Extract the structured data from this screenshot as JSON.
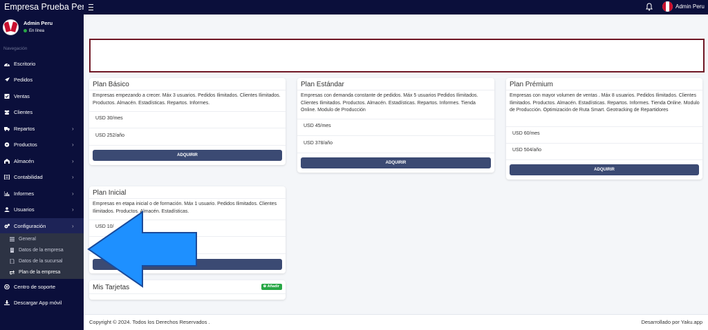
{
  "app": {
    "title": "Empresa Prueba Perú"
  },
  "topbar": {
    "user_name": "Admin Peru"
  },
  "sidebar": {
    "user": {
      "name": "Admin Peru",
      "status": "En línea"
    },
    "section_header": "Navegación",
    "items": [
      {
        "label": "Escritorio",
        "icon": "dashboard-icon",
        "has_children": false
      },
      {
        "label": "Pedidos",
        "icon": "rocket-icon",
        "has_children": false
      },
      {
        "label": "Ventas",
        "icon": "checkbox-icon",
        "has_children": false
      },
      {
        "label": "Clientes",
        "icon": "users-icon",
        "has_children": false
      },
      {
        "label": "Repartos",
        "icon": "truck-icon",
        "has_children": true
      },
      {
        "label": "Productos",
        "icon": "product-icon",
        "has_children": true
      },
      {
        "label": "Almacén",
        "icon": "warehouse-icon",
        "has_children": true
      },
      {
        "label": "Contabilidad",
        "icon": "calculator-icon",
        "has_children": true
      },
      {
        "label": "Informes",
        "icon": "chart-icon",
        "has_children": true
      },
      {
        "label": "Usuarios",
        "icon": "user-icon",
        "has_children": true
      },
      {
        "label": "Configuración",
        "icon": "gears-icon",
        "has_children": true
      },
      {
        "label": "Centro de soporte",
        "icon": "support-icon",
        "has_children": false
      },
      {
        "label": "Descargar App móvil",
        "icon": "download-icon",
        "has_children": false
      }
    ],
    "submenu": [
      {
        "label": "General",
        "icon": "list-icon"
      },
      {
        "label": "Datos de la empresa",
        "icon": "building-icon"
      },
      {
        "label": "Datos de la sucursal",
        "icon": "file-icon"
      },
      {
        "label": "Plan de la empresa",
        "icon": "exchange-icon"
      }
    ]
  },
  "plans": [
    {
      "title": "Plan Básico",
      "description": "Empresas empezando a crecer. Máx 3 usuarios. Pedidos Ilimitados. Clientes Ilimitados. Productos. Almacén. Estadísticas. Repartos. Informes.",
      "price_monthly": "USD 30/mes",
      "price_yearly": "USD 252/año",
      "button": "ADQUIRIR"
    },
    {
      "title": "Plan Estándar",
      "description": "Empresas con demanda constante de pedidos. Máx 5 usuarios Pedidos Ilimitados. Clientes Ilimitados. Productos. Almacén. Estadísticas. Repartos. Informes. Tienda Online. Modulo de Producción",
      "price_monthly": "USD 45/mes",
      "price_yearly": "USD 378/año",
      "button": "ADQUIRIR"
    },
    {
      "title": "Plan Prémium",
      "description": "Empresas con mayor volumen de ventas . Máx 8 usuarios. Pedidos Ilimitados. Clientes Ilimitados. Productos. Almacén. Estadísticas. Repartos. Informes. Tienda Online. Modulo de Producción. Optimización de Ruta Smart. Geotracking de Repartidores",
      "price_monthly": "USD 60/mes",
      "price_yearly": "USD 504/año",
      "button": "ADQUIRIR"
    },
    {
      "title": "Plan Inicial",
      "description": "Empresas en etapa inicial o de formación. Máx 1 usuario. Pedidos Ilimitados. Clientes Ilimitados. Productos. Almacén. Estadísticas.",
      "price_monthly": "USD 10/",
      "button": ""
    }
  ],
  "cards_section": {
    "title": "Mis Tarjetas",
    "add_label": "Añadir"
  },
  "footer": {
    "copyright": "Copyright © 2024. Todos los Derechos Reservados .",
    "developer": "Desarrollado por Yaku.app"
  },
  "colors": {
    "sidebar_bg": "#0b0f3b",
    "submenu_bg": "#2d3344",
    "button_bg": "#3b4a73",
    "banner_border": "#6e1624",
    "arrow_fill": "#1e90ff",
    "success": "#28a745"
  }
}
